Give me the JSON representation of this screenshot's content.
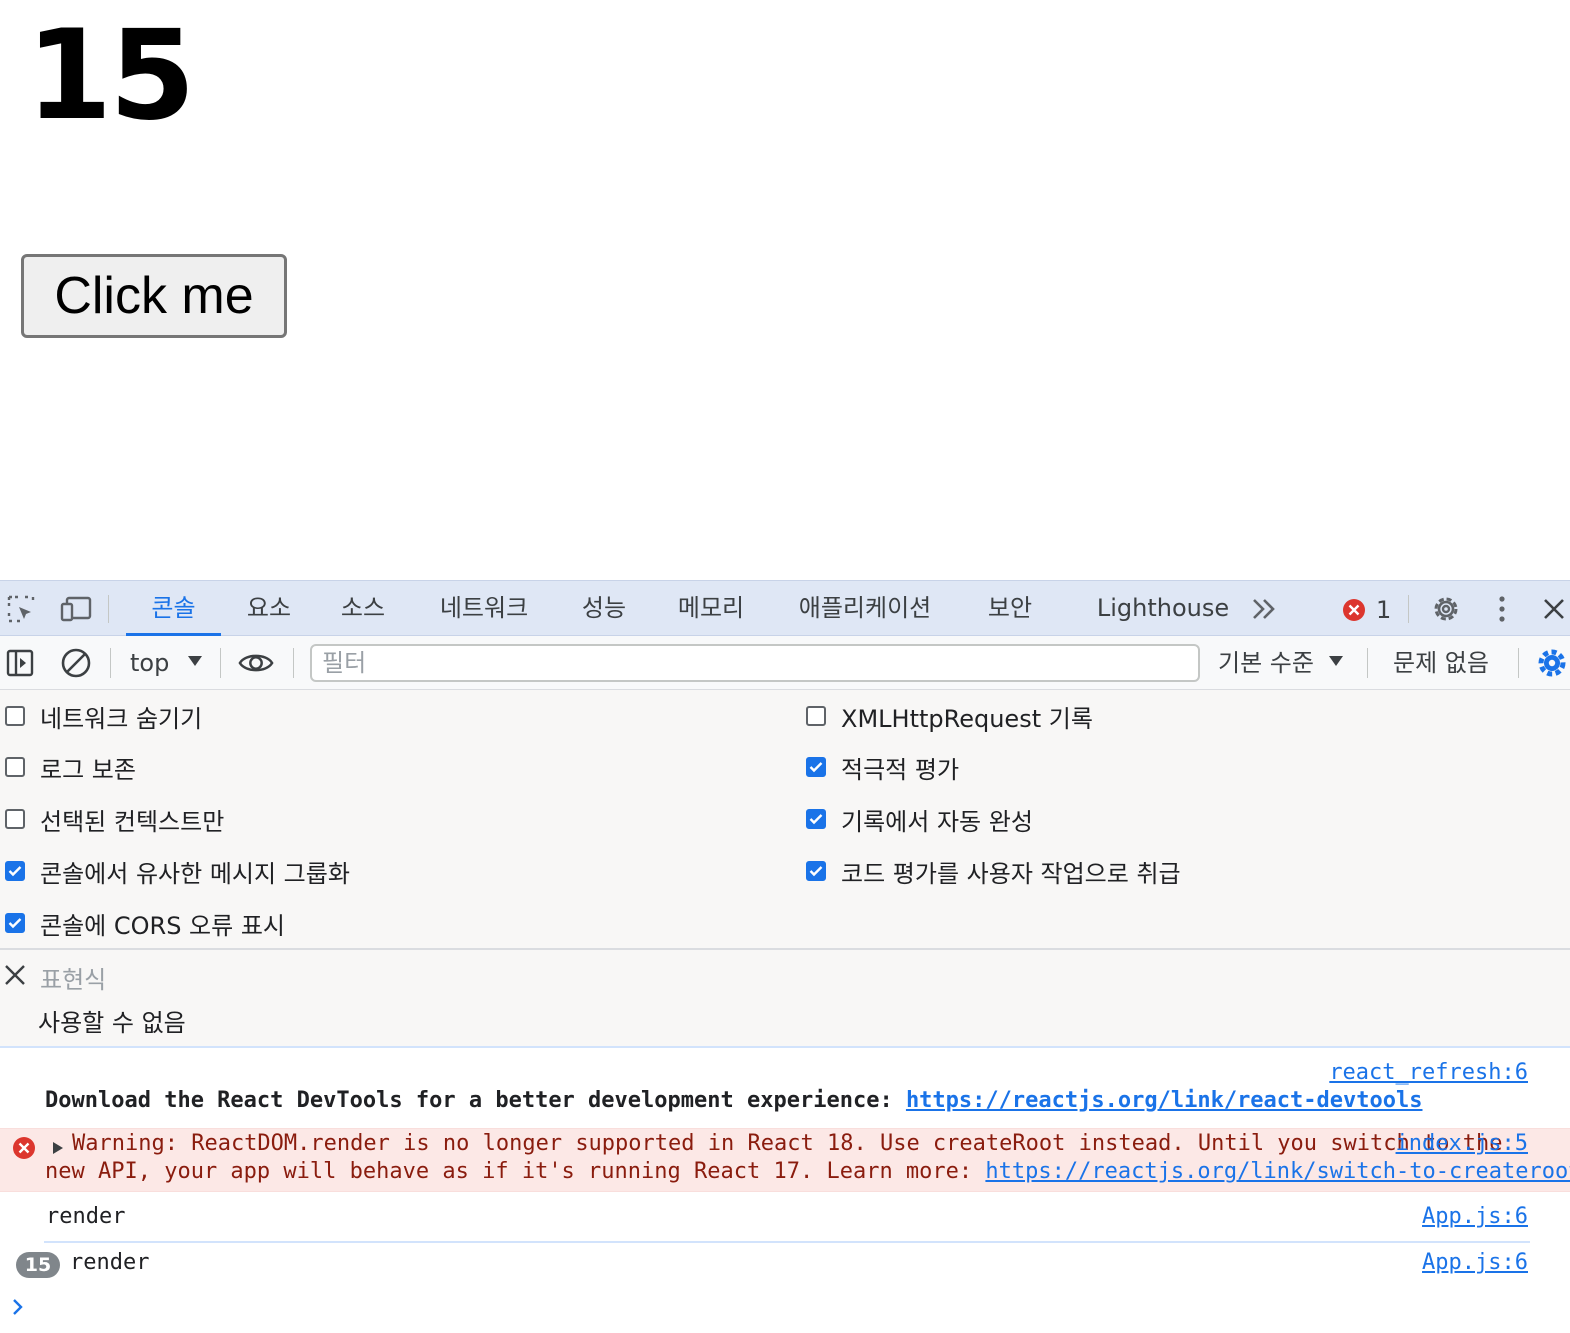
{
  "page": {
    "counter": "15",
    "button_label": "Click me"
  },
  "devtools": {
    "tabs": [
      {
        "label": "콘솔",
        "active": true
      },
      {
        "label": "요소"
      },
      {
        "label": "소스"
      },
      {
        "label": "네트워크"
      },
      {
        "label": "성능"
      },
      {
        "label": "메모리"
      },
      {
        "label": "애플리케이션"
      },
      {
        "label": "보안"
      },
      {
        "label": "Lighthouse"
      }
    ],
    "error_count": "1",
    "toolbar": {
      "context": "top",
      "filter_placeholder": "필터",
      "levels": "기본 수준",
      "issues": "문제 없음"
    },
    "settings_left": [
      {
        "label": "네트워크 숨기기",
        "checked": false
      },
      {
        "label": "로그 보존",
        "checked": false
      },
      {
        "label": "선택된 컨텍스트만",
        "checked": false
      },
      {
        "label": "콘솔에서 유사한 메시지 그룹화",
        "checked": true
      },
      {
        "label": "콘솔에 CORS 오류 표시",
        "checked": true
      }
    ],
    "settings_right": [
      {
        "label": "XMLHttpRequest 기록",
        "checked": false
      },
      {
        "label": "적극적 평가",
        "checked": true
      },
      {
        "label": "기록에서 자동 완성",
        "checked": true
      },
      {
        "label": "코드 평가를 사용자 작업으로 취급",
        "checked": true
      }
    ],
    "live_expression": {
      "placeholder": "표현식",
      "value": "사용할 수 없음"
    },
    "messages": {
      "devtools_source": "react_refresh:6",
      "devtools_text": "Download the React DevTools for a better development experience: ",
      "devtools_link": "https://reactjs.org/link/react-devtools",
      "warning_source": "index.js:5",
      "warning_line1": "Warning: ReactDOM.render is no longer supported in React 18. Use createRoot instead. Until you switch to the",
      "warning_line2": "new API, your app will behave as if it's running React 17. Learn more: ",
      "warning_link": "https://reactjs.org/link/switch-to-createroot",
      "render1_text": "render",
      "render1_source": "App.js:6",
      "render2_count": "15",
      "render2_text": "render",
      "render2_source": "App.js:6"
    },
    "colors": {
      "accent": "#1a73e8",
      "error": "#dc362e",
      "error_bg": "#fce8e6",
      "tabbar_bg": "#dfe7f5"
    }
  }
}
